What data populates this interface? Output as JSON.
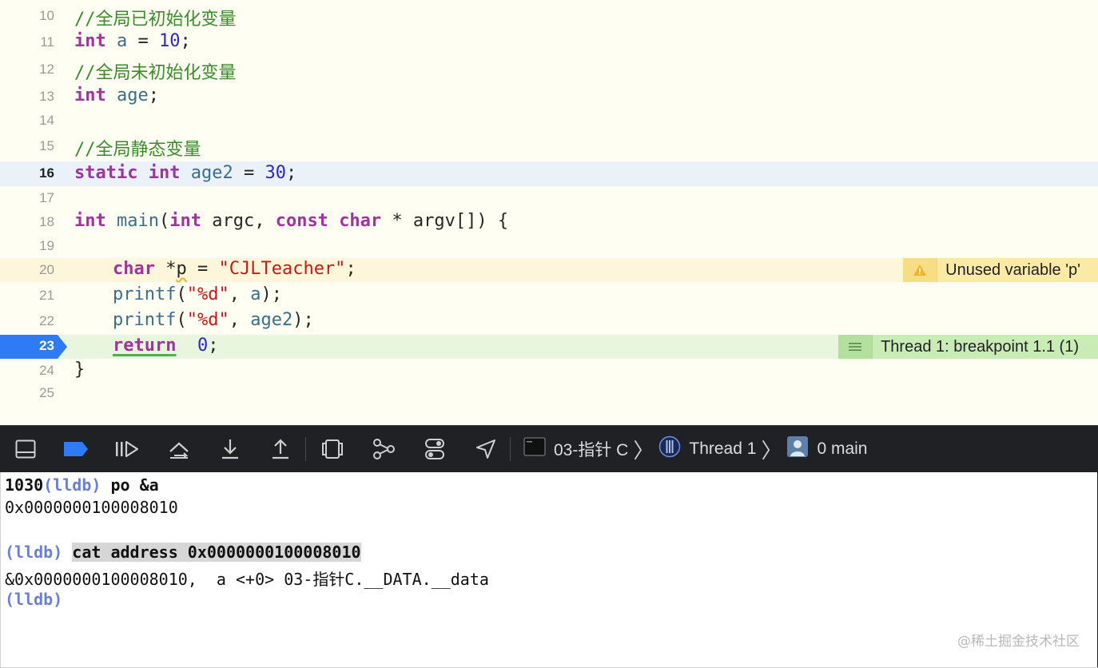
{
  "editor": {
    "lines": [
      {
        "n": "10",
        "comment": "//全局已初始化变量"
      },
      {
        "n": "11",
        "kw": "int",
        "var": "a",
        "op": " = ",
        "num": "10",
        "end": ";"
      },
      {
        "n": "12",
        "comment": "//全局未初始化变量"
      },
      {
        "n": "13",
        "kw": "int",
        "var": "age",
        "end": ";"
      },
      {
        "n": "14"
      },
      {
        "n": "15",
        "comment": "//全局静态变量"
      },
      {
        "n": "16",
        "kw1": "static",
        "kw": "int",
        "var": "age2",
        "op": " = ",
        "num": "30",
        "end": ";"
      },
      {
        "n": "17"
      },
      {
        "n": "18"
      },
      {
        "n": "19"
      },
      {
        "n": "20"
      },
      {
        "n": "21"
      },
      {
        "n": "22"
      },
      {
        "n": "23"
      },
      {
        "n": "24",
        "text": "}"
      },
      {
        "n": "25"
      }
    ],
    "main_line": {
      "kw_int": "int",
      "fn": "main",
      "open": "(",
      "kw_int2": "int",
      "args1": " argc, ",
      "kw_const": "const",
      "kw_char": "char",
      "args2": " * argv[]) {"
    },
    "line20": {
      "kw": "char",
      "star": " *",
      "var": "p",
      "op": " = ",
      "str": "\"CJLTeacher\"",
      "end": ";"
    },
    "line21": {
      "fn": "printf",
      "open": "(",
      "str": "\"%d\"",
      "rest1": ", ",
      "var": "a",
      "end": ");"
    },
    "line22": {
      "fn": "printf",
      "open": "(",
      "str": "\"%d\"",
      "rest1": ", ",
      "var": "age2",
      "end": ");"
    },
    "line23": {
      "kw": "return",
      "gap": "  ",
      "num": "0",
      "end": ";"
    },
    "warning": {
      "text": "Unused variable 'p'",
      "icon": "warning-triangle-icon",
      "color": "#fbe9a6"
    },
    "breakpoint": {
      "text": "Thread 1: breakpoint 1.1 (1)",
      "line": "23",
      "icon": "breakpoint-list-icon",
      "color": "#2f7bf5"
    }
  },
  "debug_bar": {
    "crumbs": {
      "target": "03-指针 C",
      "thread": "Thread 1",
      "frame": "0 main"
    },
    "chevron": "〉"
  },
  "console": {
    "l1_prefix": "1030",
    "prompt": "(lldb)",
    "l1_cmd": " po &a",
    "l2": "0x0000000100008010",
    "l4_cmd": "cat address 0x0000000100008010",
    "l5": "&0x0000000100008010,  a <+0> 03-指针C.__DATA.__data"
  },
  "watermark": "@稀土掘金技术社区"
}
